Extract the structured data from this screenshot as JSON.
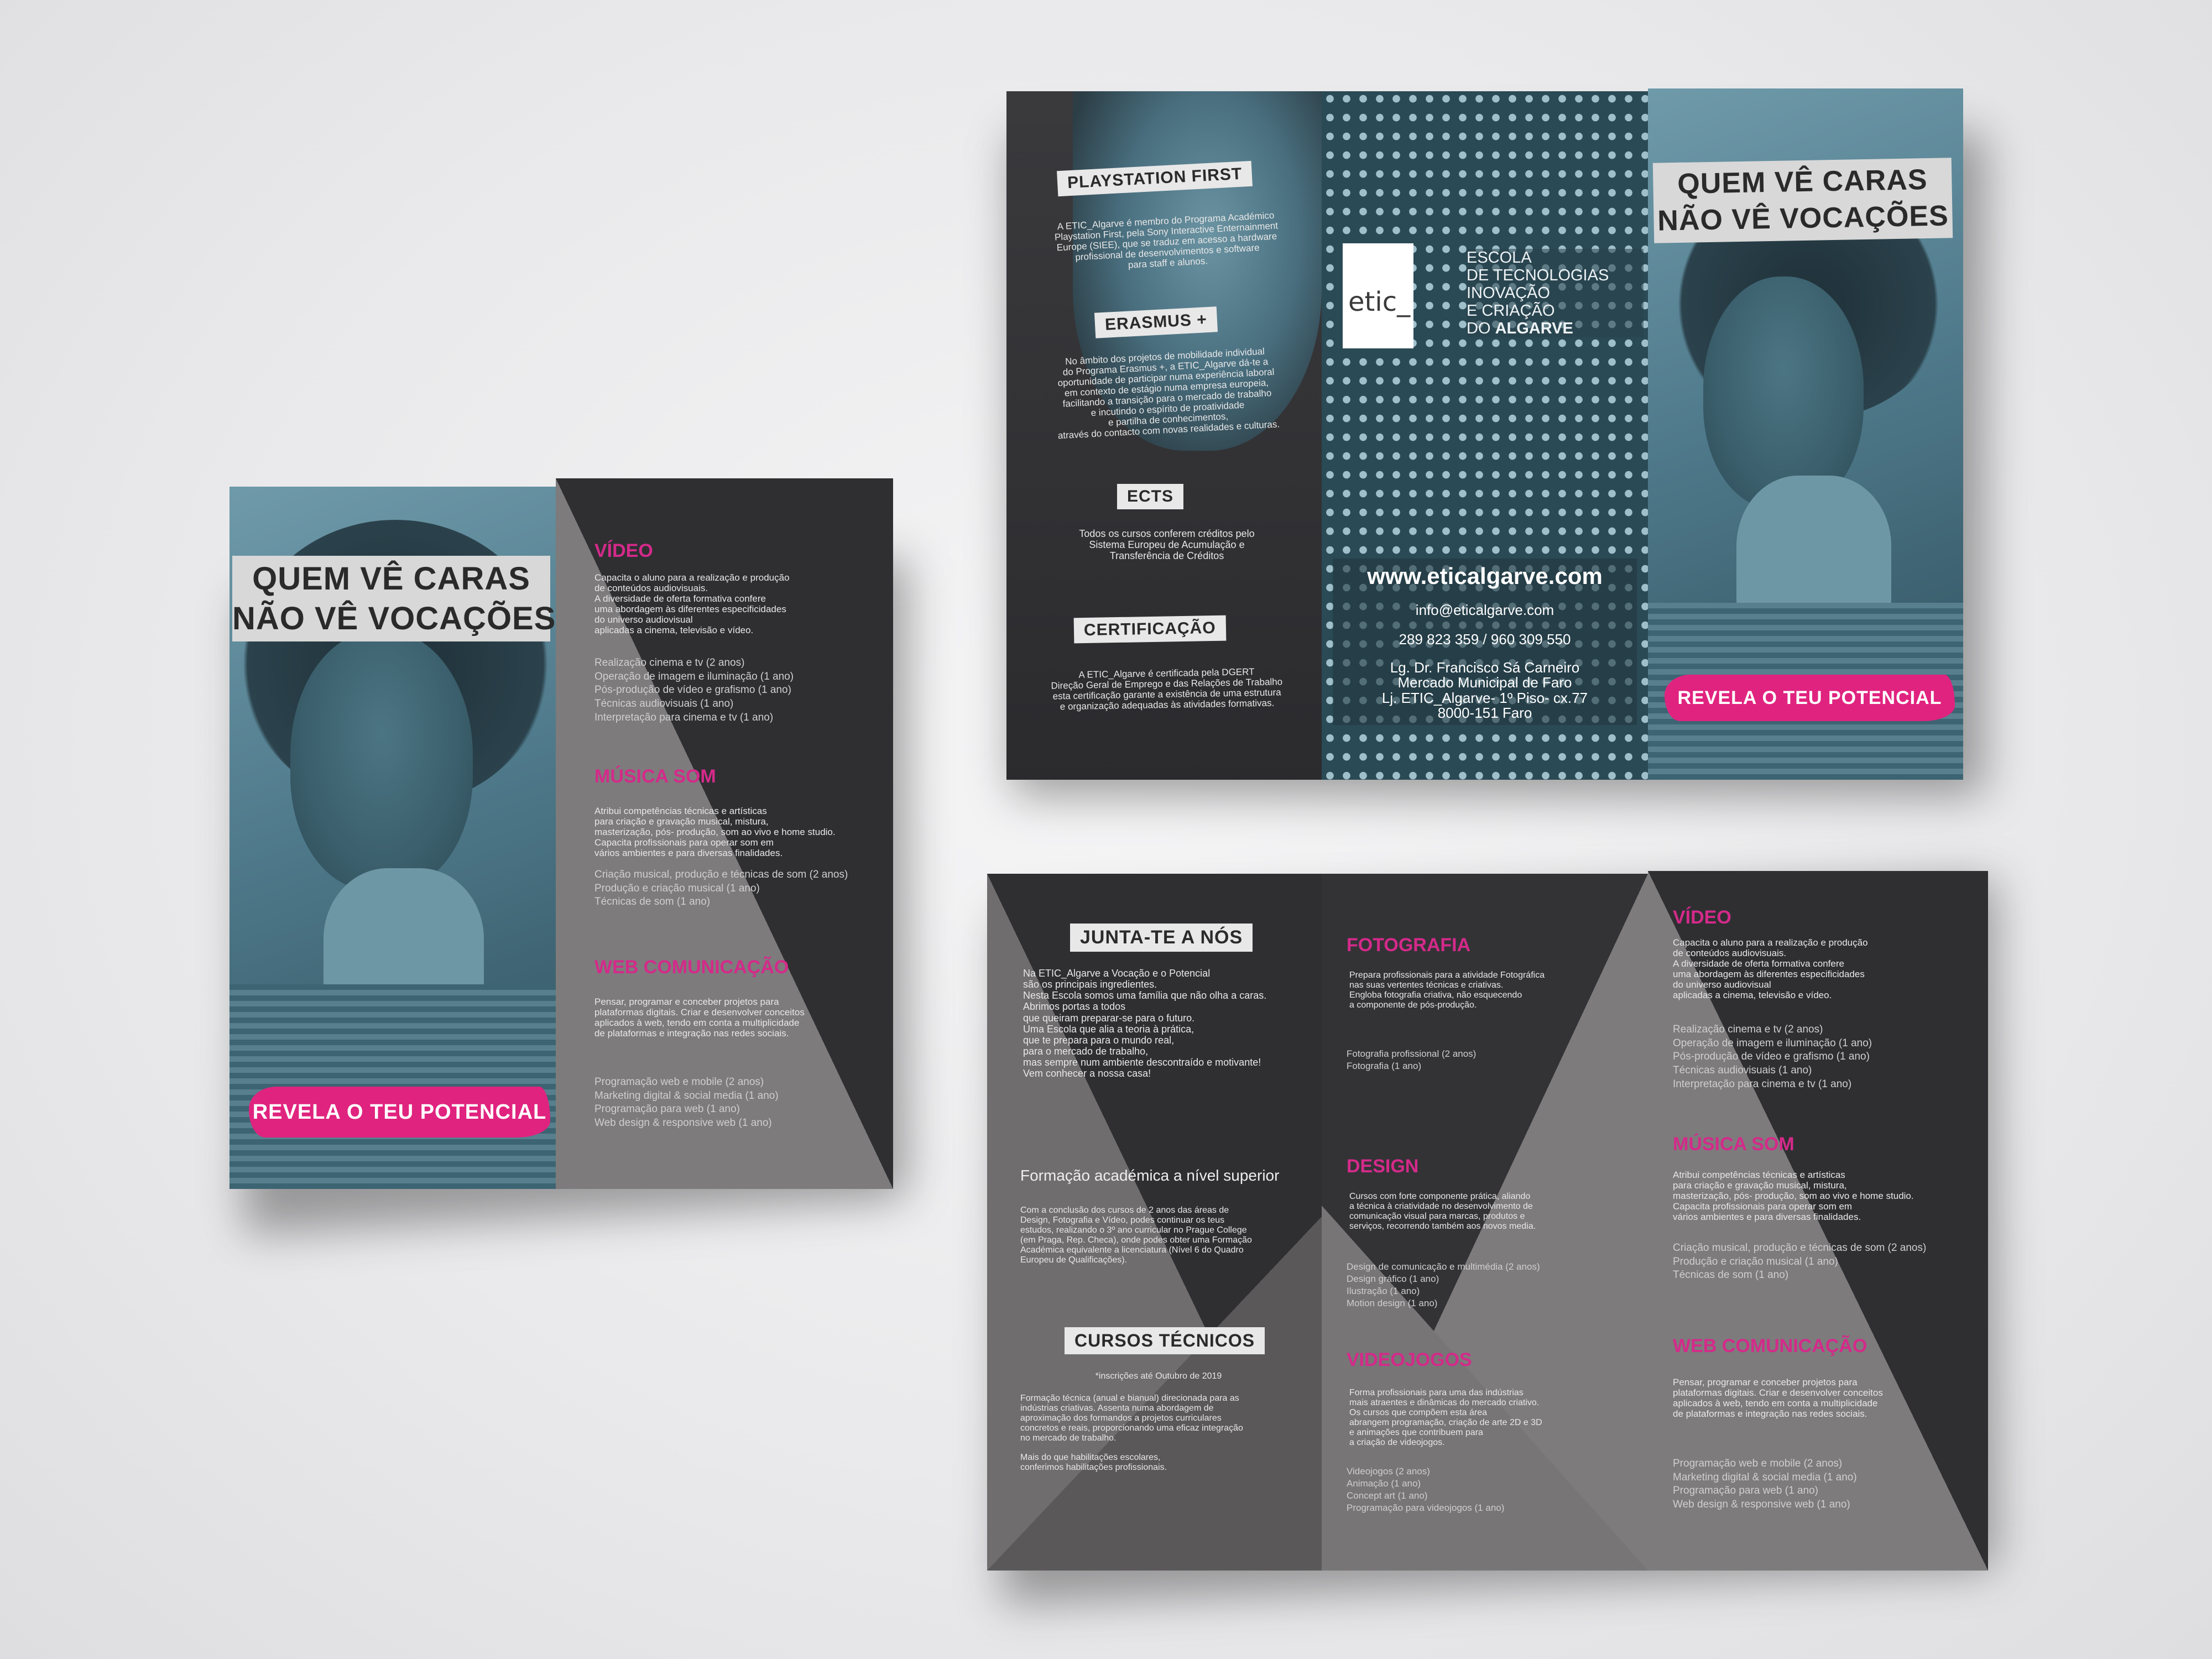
{
  "left_brochure": {
    "headline": [
      "QUEM VÊ CARAS",
      "NÃO VÊ VOCAÇÕES"
    ],
    "cta": "REVELA O TEU POTENCIAL",
    "video": {
      "title": "VÍDEO",
      "desc": "Capacita o aluno para a realização e produção\nde conteúdos audiovisuais.\nA diversidade de oferta formativa confere\numa abordagem  às diferentes especificidades\ndo  universo audiovisual\naplicadas a cinema, televisão e vídeo.",
      "courses": "Realização cinema e tv (2 anos)\nOperação de imagem e iluminação (1 ano)\nPós-produção de vídeo e grafismo (1 ano)\nTécnicas audiovisuais (1 ano)\nInterpretação para cinema e tv (1 ano)"
    },
    "musica": {
      "title": "MÚSICA SOM",
      "desc": "Atribui competências técnicas e artísticas\npara criação e gravação musical, mistura,\nmasterização, pós- produção, som ao vivo e home studio.\nCapacita profissionais para operar som em\nvários ambientes e para diversas finalidades.",
      "courses": "Criação musical, produção e técnicas de som (2 anos)\nProdução e criação musical (1 ano)\nTécnicas de som (1 ano)"
    },
    "web": {
      "title": "WEB COMUNICAÇÃO",
      "desc": "Pensar, programar e conceber projetos para\nplataformas digitais. Criar e desenvolver conceitos\naplicados à web, tendo em conta a multiplicidade\nde plataformas e integração nas redes sociais.",
      "courses": "Programação web e mobile (2 anos)\nMarketing digital & social media (1 ano)\nProgramação para web (1 ano)\nWeb design & responsive web (1 ano)"
    }
  },
  "top_brochure": {
    "playstation": {
      "title": "PLAYSTATION FIRST",
      "text": "A ETIC_Algarve é membro  do Programa Académico\nPlaystation First, pela Sony Interactive Enternainment\nEurope (SIEE), que se traduz em acesso a hardware\nprofissional de desenvolvimentos e software\npara staff e alunos."
    },
    "erasmus": {
      "title": "ERASMUS +",
      "text": "No âmbito dos projetos de mobilidade individual\ndo Programa Erasmus +, a ETIC_Algarve dá-te a\noportunidade de participar numa experiência laboral\nem contexto de estágio numa empresa europeia,\nfacilitando a transição para o mercado de trabalho\ne incutindo o espírito de proatividade\ne partilha de conhecimentos,\natravés do contacto com novas realidades e culturas."
    },
    "ects": {
      "title": "ECTS",
      "text": "Todos os cursos conferem créditos pelo\nSistema Europeu de Acumulação e\nTransferência de Créditos"
    },
    "cert": {
      "title": "CERTIFICAÇÃO",
      "text": "A ETIC_Algarve é certificada pela DGERT\nDireção Geral de Emprego e das Relações de Trabalho\nesta certificação garante a existência de uma estrutura\ne organização adequadas às atividades formativas."
    },
    "logo": "etic_",
    "school": [
      "ESCOLA",
      "DE TECNOLOGIAS",
      "INOVAÇÃO",
      "E CRIAÇÃO"
    ],
    "school_do": "DO ",
    "school_region": "ALGARVE",
    "website": "www.eticalgarve.com",
    "email": "info@eticalgarve.com",
    "phones": "289 823 359 / 960 309 550",
    "address": "Lg. Dr. Francisco Sá Carneiro\nMercado Municipal de Faro\nLj. ETIC_Algarve- 1º Piso- cx.77\n8000-151 Faro",
    "headline": [
      "QUEM VÊ CARAS",
      "NÃO VÊ VOCAÇÕES"
    ],
    "cta": "REVELA O TEU POTENCIAL"
  },
  "bottom_brochure": {
    "junta": {
      "title": "JUNTA-TE A NÓS",
      "text": "Na ETIC_Algarve a Vocação e o Potencial\nsão os principais ingredientes.\nNesta Escola somos uma família que não olha a caras.\nAbrimos portas a todos\nque queiram preparar-se para o futuro.\nUma Escola que alia a teoria à prática,\nque te prepara para o mundo real,\npara o mercado de trabalho,\nmas sempre num ambiente descontraído e motivante!\nVem conhecer a nossa casa!"
    },
    "formacao": {
      "title": "Formação académica a nível superior",
      "text": "Com a conclusão dos cursos de 2 anos das áreas de\nDesign, Fotografia e Vídeo, podes continuar os teus\nestudos, realizando o 3º ano curricular no Prague College\n(em Praga, Rep. Checa), onde podes obter uma Formação\nAcadémica equivalente a licenciatura (Nível 6 do Quadro\nEuropeu de Qualificações)."
    },
    "cursos": {
      "title": "CURSOS TÉCNICOS",
      "note": "*inscrições até Outubro de 2019",
      "text": "Formação técnica (anual e bianual) direcionada para as\nindústrias criativas. Assenta numa abordagem de\naproximação dos formandos a projetos curriculares\nconcretos e reais, proporcionando uma eficaz integração\nno mercado de trabalho.\n\nMais do que habilitações escolares,\nconferimos habilitações profissionais."
    },
    "fotografia": {
      "title": "FOTOGRAFIA",
      "desc": "Prepara profissionais para a atividade Fotográfica\nnas suas vertentes técnicas e criativas.\nEngloba fotografia criativa, não esquecendo\na componente de pós-produção.",
      "courses": "Fotografia profissional (2 anos)\nFotografia (1 ano)"
    },
    "design": {
      "title": "DESIGN",
      "desc": "Cursos com forte componente prática, aliando\na técnica à criatividade no desenvolvimento de\ncomunicação visual para marcas, produtos e\nserviços, recorrendo também aos novos media.",
      "courses": "Design de comunicação e multimédia (2 anos)\nDesign gráfico (1 ano)\nIlustração (1 ano)\nMotion design (1 ano)"
    },
    "videojogos": {
      "title": "VIDEOJOGOS",
      "desc": "Forma profissionais para uma das indústrias\nmais atraentes e dinâmicas do mercado criativo.\nOs cursos que compõem esta área\nabrangem programação, criação de arte 2D e 3D\ne animações que contribuem para\na criação de videojogos.",
      "courses": "Videojogos (2 anos)\nAnimação (1 ano)\nConcept art (1 ano)\nProgramação para videojogos (1 ano)"
    },
    "video": {
      "title": "VÍDEO",
      "desc": "Capacita o aluno para a realização e produção\nde conteúdos audiovisuais.\nA diversidade de oferta formativa confere\numa abordagem  às diferentes especificidades\ndo  universo audiovisual\naplicadas a cinema, televisão e vídeo.",
      "courses": "Realização cinema e tv (2 anos)\nOperação de imagem e iluminação (1 ano)\nPós-produção de vídeo e grafismo (1 ano)\nTécnicas audiovisuais (1 ano)\nInterpretação para cinema e tv (1 ano)"
    },
    "musica": {
      "title": "MÚSICA SOM",
      "desc": "Atribui competências técnicas e artísticas\npara criação e gravação musical, mistura,\nmasterização, pós- produção, som ao vivo e home studio.\nCapacita profissionais para operar som em\nvários ambientes e para diversas finalidades.",
      "courses": "Criação musical, produção e técnicas de som (2 anos)\nProdução e criação musical (1 ano)\nTécnicas de som (1 ano)"
    },
    "web": {
      "title": "WEB COMUNICAÇÃO",
      "desc": "Pensar, programar e conceber projetos para\nplataformas digitais. Criar e desenvolver conceitos\naplicados à web, tendo em conta a multiplicidade\nde plataformas e integração nas redes sociais.",
      "courses": "Programação web e mobile (2 anos)\nMarketing digital & social media (1 ano)\nProgramação para web (1 ano)\nWeb design & responsive web (1 ano)"
    }
  },
  "colors": {
    "accent": "#d42a8a",
    "teal": "#5e8a9b",
    "dark": "#2f2f32",
    "grey": "#7d7b7c"
  }
}
